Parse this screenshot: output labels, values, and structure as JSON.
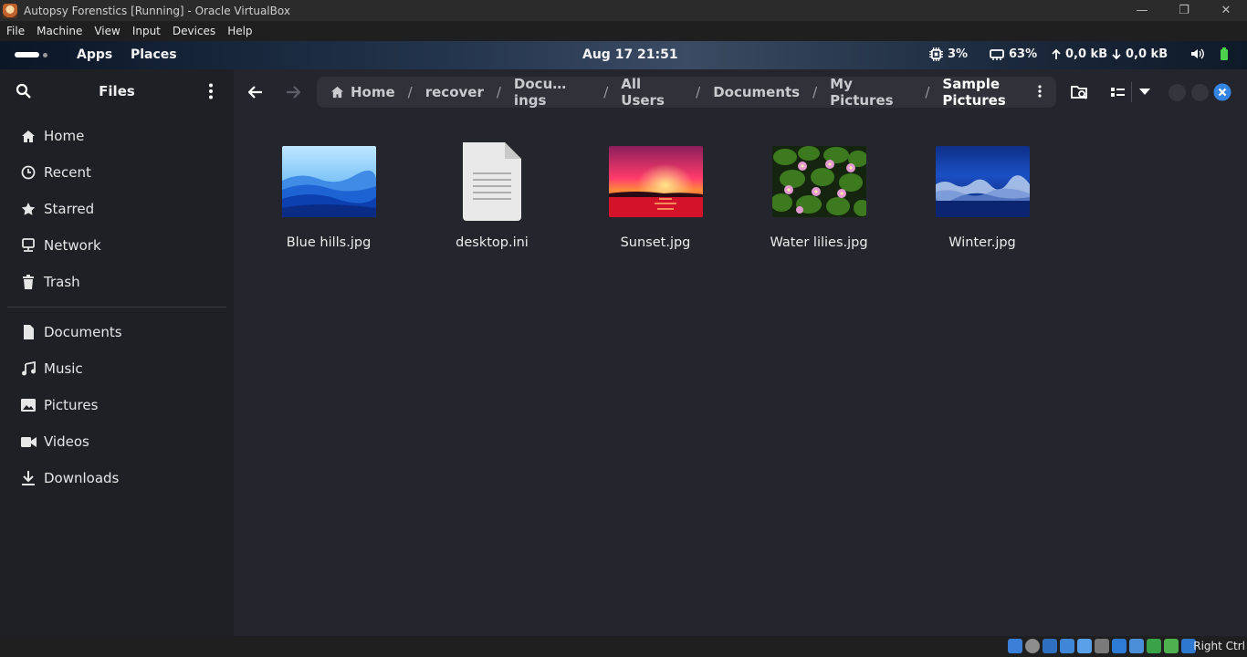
{
  "vbox": {
    "title": "Autopsy Forenstics [Running] - Oracle VirtualBox",
    "menu": [
      "File",
      "Machine",
      "View",
      "Input",
      "Devices",
      "Help"
    ],
    "host_key": "Right Ctrl"
  },
  "topbar": {
    "apps": "Apps",
    "places": "Places",
    "clock": "Aug 17  21:51",
    "cpu": "3%",
    "memory": "63%",
    "upload": "0,0 kB",
    "download": "0,0 kB"
  },
  "sidebar": {
    "title": "Files",
    "places": [
      {
        "label": "Home",
        "icon": "home-icon"
      },
      {
        "label": "Recent",
        "icon": "clock-icon"
      },
      {
        "label": "Starred",
        "icon": "star-icon"
      },
      {
        "label": "Network",
        "icon": "network-icon"
      },
      {
        "label": "Trash",
        "icon": "trash-icon"
      }
    ],
    "bookmarks": [
      {
        "label": "Documents",
        "icon": "document-icon"
      },
      {
        "label": "Music",
        "icon": "music-icon"
      },
      {
        "label": "Pictures",
        "icon": "picture-icon"
      },
      {
        "label": "Videos",
        "icon": "video-icon"
      },
      {
        "label": "Downloads",
        "icon": "download-icon"
      }
    ]
  },
  "pathbar": {
    "crumbs": [
      "Home",
      "recover",
      "Docu…ings",
      "All Users",
      "Documents",
      "My Pictures",
      "Sample Pictures"
    ]
  },
  "files": [
    {
      "name": "Blue hills.jpg",
      "kind": "image-blue-hills"
    },
    {
      "name": "desktop.ini",
      "kind": "text-document"
    },
    {
      "name": "Sunset.jpg",
      "kind": "image-sunset"
    },
    {
      "name": "Water lilies.jpg",
      "kind": "image-water-lilies"
    },
    {
      "name": "Winter.jpg",
      "kind": "image-winter"
    }
  ],
  "colors": {
    "accent": "#3584e4",
    "sidebar_bg": "#1f2026",
    "content_bg": "#24252d"
  }
}
